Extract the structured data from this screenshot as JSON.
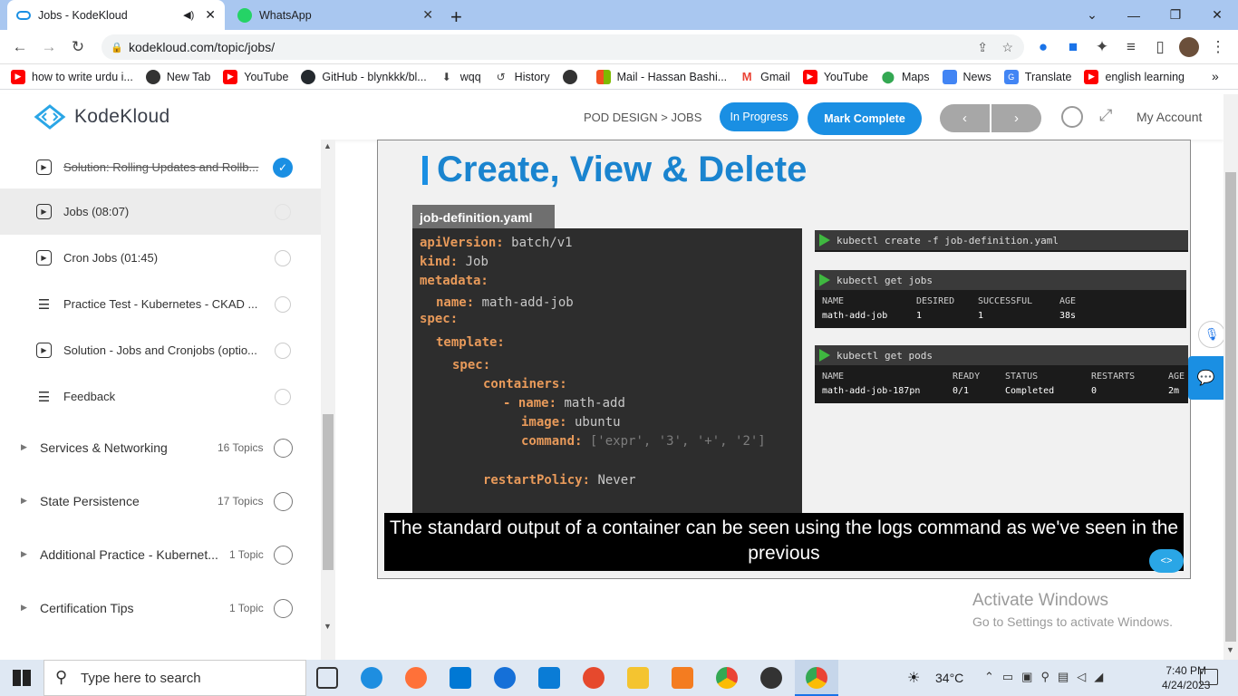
{
  "browser": {
    "tabs": [
      {
        "title": "Jobs - KodeKloud",
        "active": true,
        "audio": true
      },
      {
        "title": "WhatsApp",
        "active": false
      }
    ],
    "new_tab": "+",
    "url": "kodekloud.com/topic/jobs/",
    "bookmarks": [
      {
        "label": "how to write urdu i...",
        "icon": "youtube-icon",
        "color": "#ff0000"
      },
      {
        "label": "New Tab",
        "icon": "globe-icon",
        "color": "#333333"
      },
      {
        "label": "YouTube",
        "icon": "youtube-icon",
        "color": "#ff0000"
      },
      {
        "label": "GitHub - blynkkk/bl...",
        "icon": "github-icon",
        "color": "#24292e"
      },
      {
        "label": "wqq",
        "icon": "download-icon",
        "color": "#444444"
      },
      {
        "label": "History",
        "icon": "history-icon",
        "color": "#444444"
      },
      {
        "label": "",
        "icon": "globe-icon",
        "color": "#333333"
      },
      {
        "label": "Mail - Hassan Bashi...",
        "icon": "microsoft-icon",
        "color": "#f25022"
      },
      {
        "label": "Gmail",
        "icon": "gmail-icon",
        "color": "#ea4335"
      },
      {
        "label": "YouTube",
        "icon": "youtube-icon",
        "color": "#ff0000"
      },
      {
        "label": "Maps",
        "icon": "maps-icon",
        "color": "#34a853"
      },
      {
        "label": "News",
        "icon": "news-icon",
        "color": "#4285f4"
      },
      {
        "label": "Translate",
        "icon": "translate-icon",
        "color": "#4285f4"
      },
      {
        "label": "english learning",
        "icon": "youtube-icon",
        "color": "#ff0000"
      }
    ],
    "more_bookmarks": "»"
  },
  "site": {
    "brand": "KodeKloud",
    "breadcrumb": "POD DESIGN > JOBS",
    "status_button": "In Progress",
    "mark_complete": "Mark Complete",
    "prev": "‹",
    "next": "›",
    "account": "My Account",
    "accent": "#1a8fe3"
  },
  "sidebar": {
    "lessons": [
      {
        "title": "Solution: Rolling Updates and Rollb...",
        "icon": "play-icon",
        "done": true
      },
      {
        "title": "Jobs (08:07)",
        "icon": "play-icon",
        "done": false,
        "current": true
      },
      {
        "title": "Cron Jobs (01:45)",
        "icon": "play-icon",
        "done": false
      },
      {
        "title": "Practice Test - Kubernetes - CKAD ...",
        "icon": "list-icon",
        "done": false
      },
      {
        "title": "Solution - Jobs and Cronjobs (optio...",
        "icon": "play-icon",
        "done": false
      },
      {
        "title": "Feedback",
        "icon": "list-icon",
        "done": false
      }
    ],
    "sections": [
      {
        "title": "Services & Networking",
        "count": "16 Topics"
      },
      {
        "title": "State Persistence",
        "count": "17 Topics"
      },
      {
        "title": "Additional Practice - Kubernet...",
        "count": "1 Topic"
      },
      {
        "title": "Certification Tips",
        "count": "1 Topic"
      }
    ]
  },
  "video": {
    "slide_title": "Create, View & Delete",
    "file_tab": "job-definition.yaml",
    "yaml_lines": [
      {
        "key": "apiVersion:",
        "val": "batch/v1",
        "indent": 0
      },
      {
        "key": "kind:",
        "val": "Job",
        "indent": 0
      },
      {
        "key": "metadata:",
        "val": "",
        "indent": 0
      },
      {
        "key": "name:",
        "val": "math-add-job",
        "indent": 1
      },
      {
        "key": "spec:",
        "val": "",
        "indent": 0
      },
      {
        "key": "template:",
        "val": "",
        "indent": 1
      },
      {
        "key": "spec:",
        "val": "",
        "indent": 2
      },
      {
        "key": "containers:",
        "val": "",
        "indent": 3
      },
      {
        "key": "- name:",
        "val": "math-add",
        "indent": 4
      },
      {
        "key": "image:",
        "val": "ubuntu",
        "indent": 5
      },
      {
        "key": "command:",
        "val": "['expr', '3', '+', '2']",
        "indent": 5
      },
      {
        "key": "restartPolicy:",
        "val": "Never",
        "indent": 3
      }
    ],
    "terminals": [
      {
        "cmd": "kubectl create -f job-definition.yaml",
        "headers": [],
        "rows": []
      },
      {
        "cmd": "kubectl get jobs",
        "headers": [
          "NAME",
          "DESIRED",
          "SUCCESSFUL",
          "AGE"
        ],
        "rows": [
          [
            "math-add-job",
            "1",
            "1",
            "38s"
          ]
        ]
      },
      {
        "cmd": "kubectl get pods",
        "headers": [
          "NAME",
          "READY",
          "STATUS",
          "RESTARTS",
          "AGE"
        ],
        "rows": [
          [
            "math-add-job-187pn",
            "0/1",
            "Completed",
            "0",
            "2m"
          ]
        ]
      }
    ],
    "caption": "The standard output of a container can be seen using the logs command as we've seen in the previous"
  },
  "watermark": {
    "title": "Activate Windows",
    "subtitle": "Go to Settings to activate Windows."
  },
  "taskbar": {
    "search_placeholder": "Type here to search",
    "weather": "34°C",
    "time": "7:40 PM",
    "date": "4/24/2023"
  }
}
